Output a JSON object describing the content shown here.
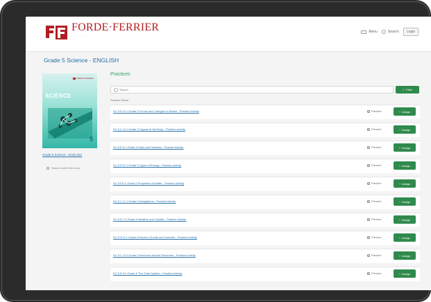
{
  "header": {
    "logo_name": "FORDE·FERRIER",
    "logo_tagline": "· · · · · · · · ·",
    "nav_menu": "Menu",
    "nav_search": "Search",
    "nav_button": "Login"
  },
  "breadcrumb": "Grade 5 Science - ENGLISH",
  "book": {
    "cover_title": "SCIENCE",
    "cover_publisher": "FORDE·FERRIER",
    "cover_grade": "5",
    "link": "Grade 5 Science - ENGLISH",
    "search_label": "Search within this book"
  },
  "practices": {
    "title": "Practices",
    "filter_placeholder": "Search",
    "filter_button": "Filter",
    "column_header": "Practice Name",
    "preview_label": "Preview",
    "assign_label": "Assign",
    "items": [
      "SC.5.P.13.1 Grade 5 Forces and Changes in Motion - Practice Activity",
      "SC.5.L.14.1 Grade 5 Organs of the Body - Practice Activity",
      "SC.5.E.5.1 Grade 5 Stars and Galaxies - Practice Activity",
      "SC.5.P.10.1 Grade 5 Types of Energy - Practice Activity",
      "SC.5.P.8.1 Grade 5 Properties of Matter - Practice Activity",
      "SC.5.L.17.1 Grade 5 Adaptations - Practice Activity",
      "SC.5.E.7.3 Grade 5 Weather and Climate - Practice Activity",
      "SC.5.P.11.1 Grade 5 Electric Circuits and Currents - Practice Activity",
      "SC.5.L.14.2 Grade 5 Plant and Animal Structures - Practice Activity",
      "SC.5.E.5.2 Grade 5 The Solar System - Practice Activity"
    ]
  },
  "colors": {
    "brand_red": "#b01e23",
    "accent_green": "#2f8a4d",
    "link_blue": "#2a72aa"
  }
}
